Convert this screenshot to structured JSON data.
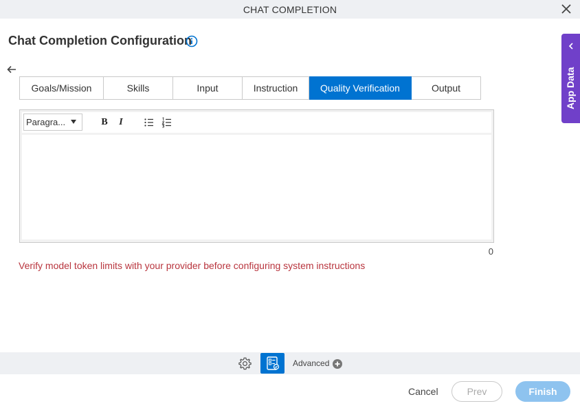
{
  "window": {
    "title": "CHAT COMPLETION",
    "close_icon": "close-icon"
  },
  "heading": {
    "title": "Chat Completion Configuration",
    "info_icon": "info-icon"
  },
  "tabs": [
    {
      "label": "Goals/Mission",
      "active": false
    },
    {
      "label": "Skills",
      "active": false
    },
    {
      "label": "Input",
      "active": false
    },
    {
      "label": "Instruction",
      "active": false
    },
    {
      "label": "Quality Verification",
      "active": true
    },
    {
      "label": "Output",
      "active": false
    }
  ],
  "editor": {
    "paragraph_select": "Paragra...",
    "bold": "B",
    "italic": "I",
    "value": "",
    "char_count": "0"
  },
  "warning": "Verify model token limits with your provider before configuring system instructions",
  "footer": {
    "advanced_label": "Advanced",
    "cancel_label": "Cancel",
    "prev_label": "Prev",
    "finish_label": "Finish"
  },
  "side_panel": {
    "label": "App Data"
  },
  "colors": {
    "accent": "#0073d1",
    "app_data": "#7040c9",
    "warning": "#b8343d",
    "finish_disabled": "#8ec3ef"
  }
}
